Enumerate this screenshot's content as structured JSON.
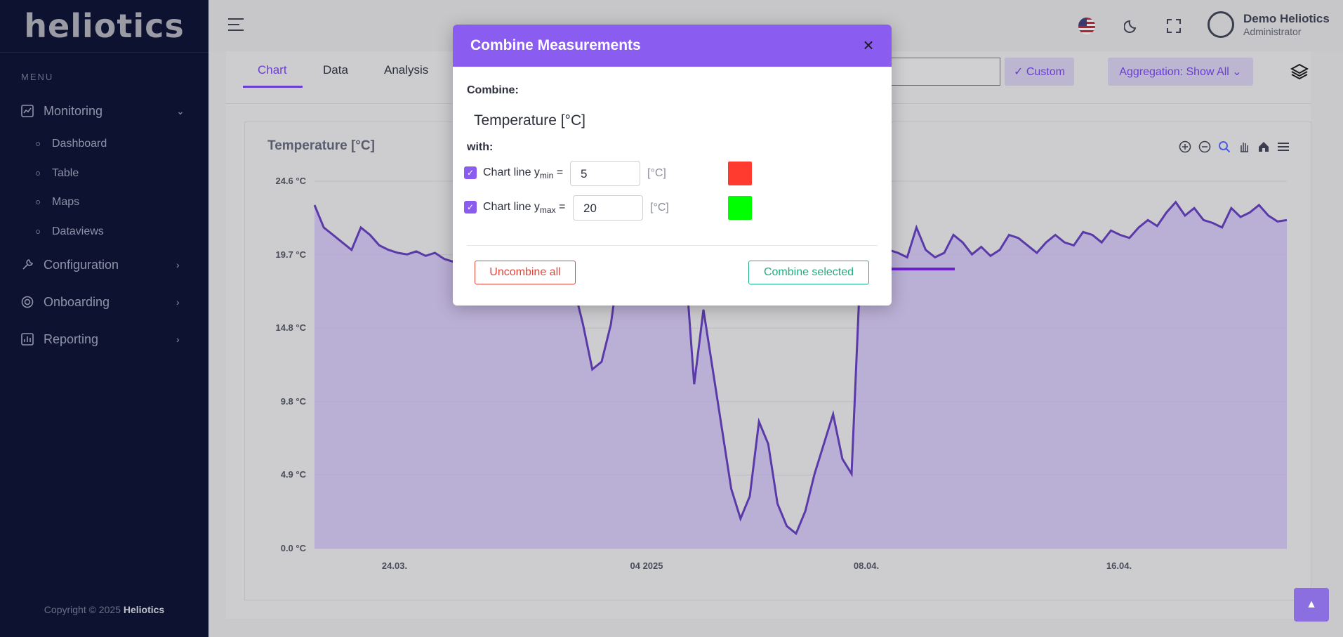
{
  "brand": {
    "logo_text": "heliotics"
  },
  "sidebar": {
    "menu_title": "MENU",
    "items": [
      {
        "label": "Monitoring",
        "icon": "chart-line-icon",
        "expanded": true
      },
      {
        "label": "Configuration",
        "icon": "wrench-icon"
      },
      {
        "label": "Onboarding",
        "icon": "onboarding-icon"
      },
      {
        "label": "Reporting",
        "icon": "report-icon"
      }
    ],
    "sub_items": [
      "Dashboard",
      "Table",
      "Maps",
      "Dataviews"
    ],
    "copyright_prefix": "Copyright © 2025 ",
    "copyright_brand": "Heliotics"
  },
  "topbar": {
    "user_name": "Demo Heliotics",
    "user_role": "Administrator"
  },
  "toolbar": {
    "tabs": [
      "Chart",
      "Data",
      "Analysis"
    ],
    "active_tab": "Chart",
    "date_value": "o",
    "custom_label": "✓ Custom",
    "aggregation_label": "Aggregation: Show All ⌄"
  },
  "chart_data": {
    "type": "area",
    "title": "Temperature [°C]",
    "y_ticks": [
      "24.6 °C",
      "19.7 °C",
      "14.8 °C",
      "9.8 °C",
      "4.9 °C",
      "0.0 °C"
    ],
    "x_ticks": [
      "24.03.",
      "04 2025",
      "08.04.",
      "16.04."
    ],
    "ylim": [
      0,
      24.6
    ],
    "grid": true,
    "series": [
      {
        "color": "#5a3aa8",
        "fill": "#b6a9d6",
        "values": [
          23,
          21.5,
          21,
          20.5,
          20,
          21.5,
          21,
          20.3,
          20,
          19.8,
          19.7,
          19.9,
          19.6,
          19.8,
          19.4,
          19.2,
          22,
          21,
          20.5,
          20.2,
          20.7,
          21.5,
          20.8,
          20.2,
          19.5,
          19.8,
          20.5,
          19.8,
          17.5,
          15,
          12,
          12.5,
          15,
          19.5,
          20,
          20.5,
          20.2,
          19.8,
          20.2,
          20.5,
          19.5,
          11,
          16,
          12,
          8,
          4,
          2,
          3.5,
          8.5,
          7,
          3,
          1.5,
          1,
          2.5,
          5,
          7,
          9,
          6,
          5,
          19.5,
          19.6,
          22.5,
          20,
          19.8,
          19.5,
          21.5,
          20,
          19.5,
          19.8,
          21,
          20.5,
          19.7,
          20.2,
          19.6,
          20,
          21,
          20.8,
          20.3,
          19.8,
          20.5,
          21,
          20.5,
          20.3,
          21.2,
          21,
          20.5,
          21.3,
          21,
          20.8,
          21.5,
          22,
          21.6,
          22.5,
          23.2,
          22.3,
          22.8,
          22,
          21.8,
          21.5,
          22.8,
          22.2,
          22.5,
          23,
          22.3,
          21.9,
          22
        ]
      }
    ]
  },
  "modal": {
    "title": "Combine Measurements",
    "combine_label": "Combine:",
    "measurement": "Temperature [°C]",
    "with_label": "with:",
    "rows": [
      {
        "label_prefix": "Chart line y",
        "sub": "min",
        "label_suffix": " =",
        "value": "5",
        "unit": "[°C]",
        "color": "#ff3b30",
        "checked": true
      },
      {
        "label_prefix": "Chart line y",
        "sub": "max",
        "label_suffix": " =",
        "value": "20",
        "unit": "[°C]",
        "color": "#00ff00",
        "checked": true
      }
    ],
    "uncombine_label": "Uncombine all",
    "combine_label_btn": "Combine selected"
  }
}
